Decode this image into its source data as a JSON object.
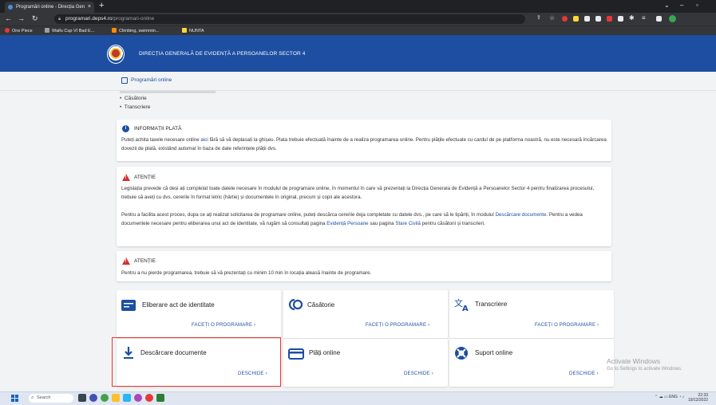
{
  "browser": {
    "tab_title": "Programări online - Direcția Gen",
    "tab_close": "×",
    "new_tab": "+",
    "url_host": "programari.deps4.ro",
    "url_path": "/programari-online",
    "bookmarks": [
      "One Piece",
      "Waifu Cup VI Bad E...",
      "Climbing, swimmin...",
      "NUNTA"
    ]
  },
  "site": {
    "title": "DIRECȚIA GENERALĂ DE EVIDENȚĂ A PERSOANELOR SECTOR 4",
    "subnav_label": "Programări online"
  },
  "list_items": [
    "Căsătorie",
    "Transcriere"
  ],
  "payment_info": {
    "title": "INFORMAȚII PLATĂ",
    "text_before_link": "Puteți achita taxele necesare online ",
    "link": "aici",
    "text_after_link": " fără să vă deplasați la ghișeu. Plata trebuie efectuată înainte de a realiza programarea online. Pentru plățile efectuate cu cardul de pe platforma noastră, nu este necesară încărcarea dovezii de plată, existând automat în baza de date referințele plății dvs."
  },
  "attention1": {
    "title": "ATENȚIE",
    "p1": "Legislația prevede că deși ați completat toate datele necesare în modulul de programare online, în momentul în care vă prezentați la Direcția Generala de Evidență a Persoanelor Sector 4 pentru finalizarea procesului, trebuie să aveți cu dvs. cererile în format letric (hârtie) și documentele în original, precum și copii ale acestora.",
    "p2_a": "Pentru a facilita acest proces, dupa ce ați realizat solicitarea de programare online, puteți descărca cererile deja completate cu datele dvs., pe care să le tipăriți, în modulul ",
    "p2_link1": "Descărcare documente",
    "p2_b": ". Pentru a vedea documentele necesare pentru eliberarea unui act de identitate, vă rugăm să consultați pagina ",
    "p2_link2": "Evidență Persoane",
    "p2_c": " sau pagina ",
    "p2_link3": "Stare Civilă",
    "p2_d": " pentru căsătorii și transcrieri."
  },
  "attention2": {
    "title": "ATENȚIE",
    "text": "Pentru a nu pierde programarea, trebuie să vă prezentați cu minim 10 min în locația aleasă înainte de programare."
  },
  "services": [
    {
      "title": "Eliberare act de identitate",
      "action": "FACEȚI O PROGRAMARE  ›",
      "icon": "id-card-icon"
    },
    {
      "title": "Căsătorie",
      "action": "FACEȚI O PROGRAMARE  ›",
      "icon": "rings-icon"
    },
    {
      "title": "Transcriere",
      "action": "FACEȚI O PROGRAMARE  ›",
      "icon": "translate-icon"
    },
    {
      "title": "Descărcare documente",
      "action": "DESCHIDE  ›",
      "icon": "download-icon"
    },
    {
      "title": "Plăți online",
      "action": "DESCHIDE  ›",
      "icon": "credit-card-icon"
    },
    {
      "title": "Suport online",
      "action": "DESCHIDE  ›",
      "icon": "support-icon"
    }
  ],
  "windows": {
    "activate_title": "Activate Windows",
    "activate_sub": "Go to Settings to activate Windows.",
    "search": "Search",
    "lang": "ENG",
    "time": "22:33",
    "date": "19/12/2022"
  },
  "colors": {
    "brand": "#1d4ea1",
    "warning": "#d32f2f",
    "highlight": "#e53935"
  }
}
